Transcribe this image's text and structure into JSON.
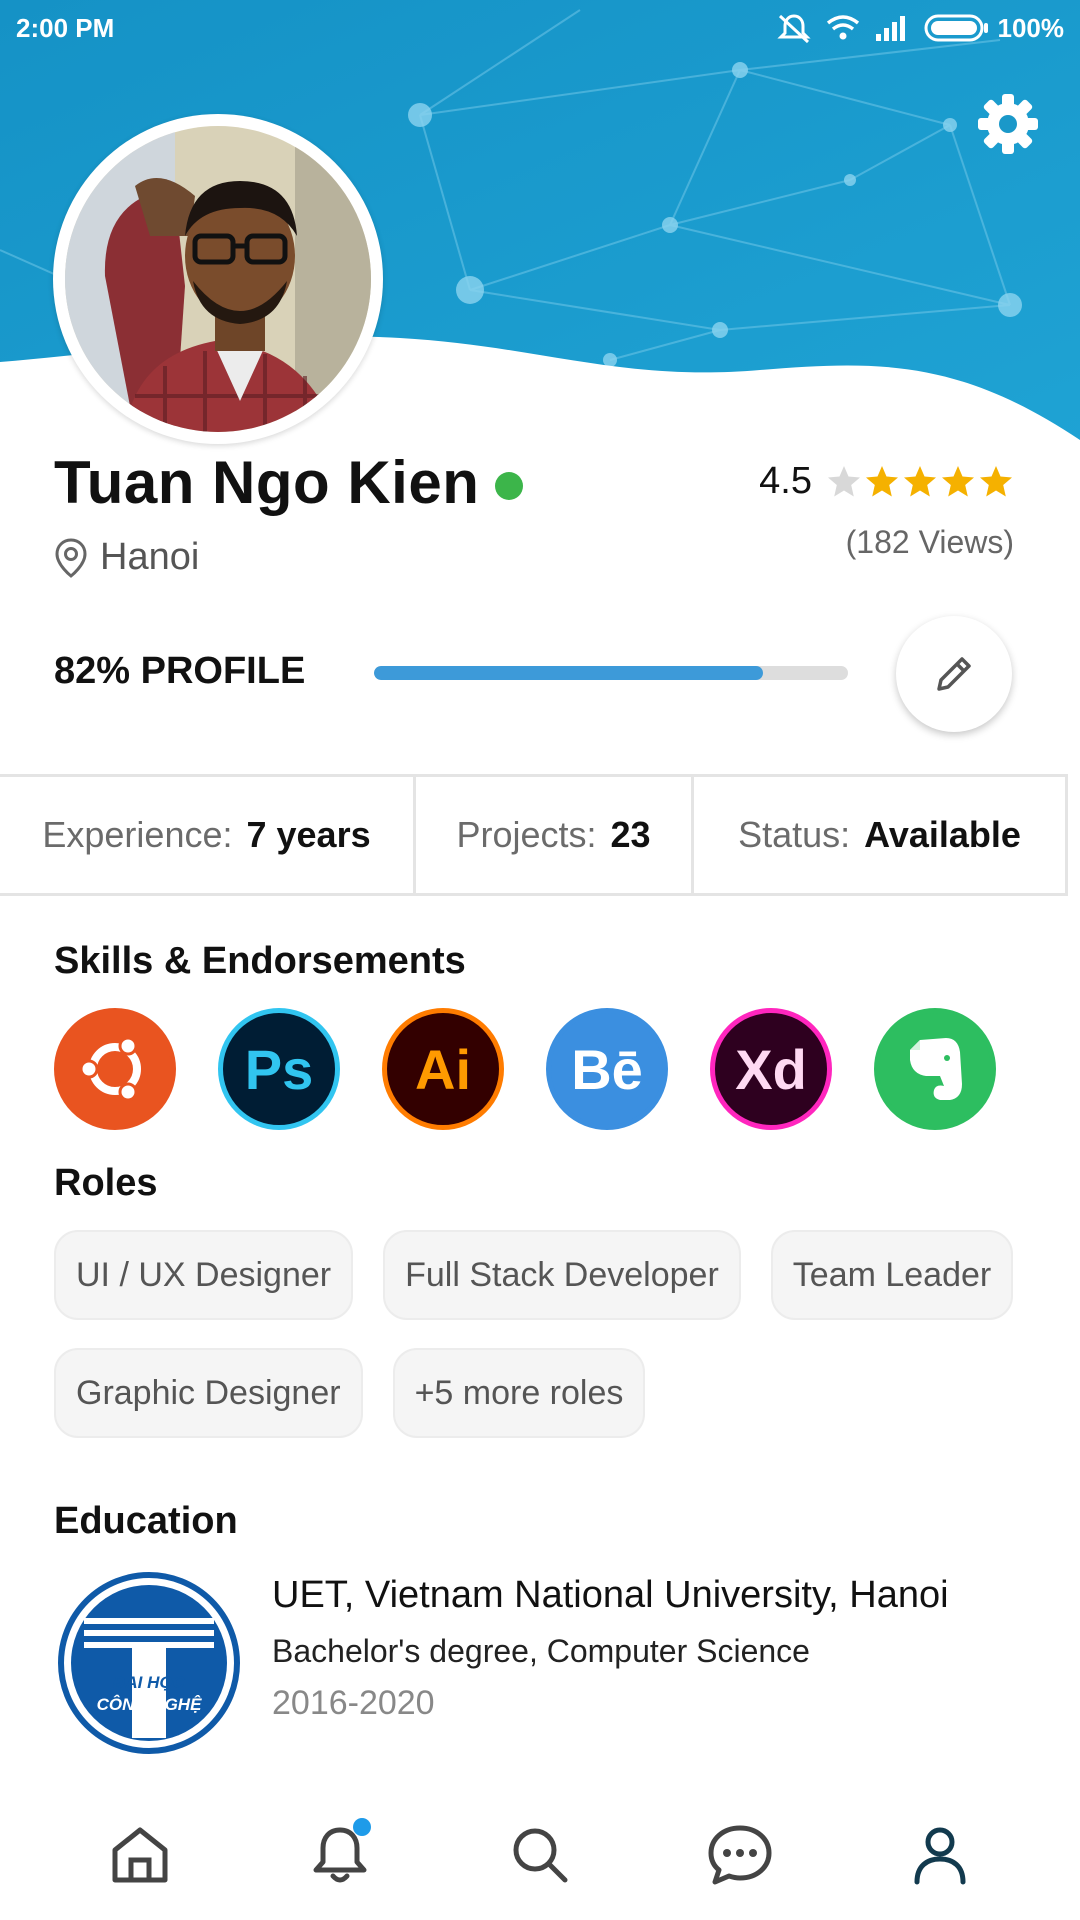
{
  "status_bar": {
    "time": "2:00 PM",
    "battery": "100%",
    "icons": [
      "mute-icon",
      "wifi-icon",
      "signal-icon",
      "battery-icon"
    ]
  },
  "header": {
    "settings_icon": "gear-icon",
    "accent_color": "#1a98c9"
  },
  "profile": {
    "name": "Tuan Ngo Kien",
    "online": true,
    "location": "Hanoi",
    "rating": "4.5",
    "rating_value": 4.5,
    "rating_max": 5,
    "views": "(182 Views)",
    "completion_label": "82% PROFILE",
    "completion_fraction": 0.82,
    "progress_color": "#3d9ad9"
  },
  "stats": [
    {
      "label": "Experience:",
      "value": "7 years"
    },
    {
      "label": "Projects:",
      "value": "23"
    },
    {
      "label": "Status:",
      "value": "Available"
    }
  ],
  "skills": {
    "title": "Skills & Endorsements",
    "items": [
      {
        "name": "ubuntu-icon",
        "text": "",
        "bg": "#e95420",
        "fg": "#ffffff",
        "ring": "#e95420"
      },
      {
        "name": "photoshop-icon",
        "text": "Ps",
        "bg": "#001d34",
        "fg": "#31c5f0",
        "ring": "#31c5f0"
      },
      {
        "name": "illustrator-icon",
        "text": "Ai",
        "bg": "#330000",
        "fg": "#ff9a00",
        "ring": "#ff7c00"
      },
      {
        "name": "behance-icon",
        "text": "Bē",
        "bg": "#3b8fe0",
        "fg": "#ffffff",
        "ring": "#3b8fe0"
      },
      {
        "name": "xd-icon",
        "text": "Xd",
        "bg": "#2e001f",
        "fg": "#ffd9f2",
        "ring": "#ff26be"
      },
      {
        "name": "evernote-icon",
        "text": "",
        "bg": "#2dbe60",
        "fg": "#ffffff",
        "ring": "#2dbe60"
      }
    ]
  },
  "roles": {
    "title": "Roles",
    "items": [
      "UI / UX Designer",
      "Full Stack Developer",
      "Team Leader",
      "Graphic Designer",
      "+5 more roles"
    ]
  },
  "education": {
    "title": "Education",
    "school": "UET, Vietnam National University, Hanoi",
    "degree": "Bachelor's degree, Computer Science",
    "years": "2016-2020",
    "logo_text_1": "ĐẠI HỌC",
    "logo_text_2": "CÔNG NGHỆ"
  },
  "bottom_nav": {
    "items": [
      "home-icon",
      "bell-icon",
      "search-icon",
      "chat-icon",
      "profile-icon"
    ],
    "active": "profile-icon",
    "notification_color": "#1e9be9"
  }
}
